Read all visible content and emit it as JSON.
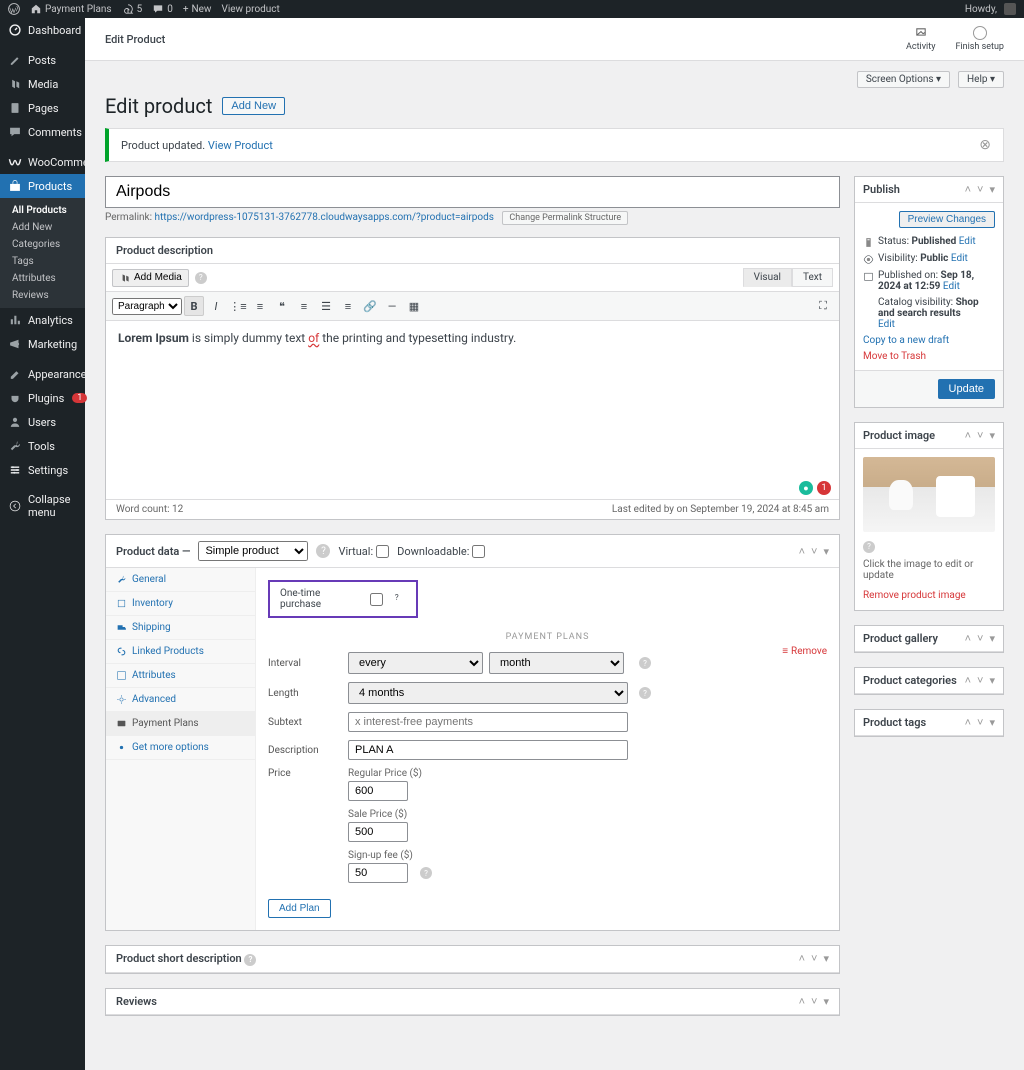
{
  "topbar": {
    "site_name": "Payment Plans",
    "updates": "5",
    "comments": "0",
    "new": "New",
    "view": "View product",
    "howdy": "Howdy,"
  },
  "sidebar": {
    "items": [
      {
        "label": "Dashboard"
      },
      {
        "label": "Posts"
      },
      {
        "label": "Media"
      },
      {
        "label": "Pages"
      },
      {
        "label": "Comments"
      },
      {
        "label": "WooCommerce"
      },
      {
        "label": "Products"
      },
      {
        "label": "Analytics"
      },
      {
        "label": "Marketing"
      },
      {
        "label": "Appearance"
      },
      {
        "label": "Plugins"
      },
      {
        "label": "Users"
      },
      {
        "label": "Tools"
      },
      {
        "label": "Settings"
      },
      {
        "label": "Collapse menu"
      }
    ],
    "plugins_badge": "1",
    "sub": [
      {
        "label": "All Products"
      },
      {
        "label": "Add New"
      },
      {
        "label": "Categories"
      },
      {
        "label": "Tags"
      },
      {
        "label": "Attributes"
      },
      {
        "label": "Reviews"
      }
    ]
  },
  "breadcrumb": "Edit Product",
  "setup": {
    "activity": "Activity",
    "finish": "Finish setup"
  },
  "screen_options": "Screen Options ▾",
  "help": "Help ▾",
  "page_title": "Edit product",
  "add_new": "Add New",
  "notice": {
    "text": "Product updated. ",
    "link": "View Product"
  },
  "product": {
    "title": "Airpods",
    "permalink_label": "Permalink:",
    "permalink_url": "https://wordpress-1075131-3762778.cloudwaysapps.com/?product=airpods",
    "change_permalink": "Change Permalink Structure"
  },
  "description": {
    "heading": "Product description",
    "add_media": "Add Media",
    "tabs": {
      "visual": "Visual",
      "text": "Text"
    },
    "paragraph": "Paragraph",
    "content_bold": "Lorem Ipsum",
    "content_rest_1": " is simply dummy text ",
    "content_err": "of",
    "content_rest_2": " the printing and typesetting industry.",
    "word_count": "Word count: 12",
    "last_edited": "Last edited by on September 19, 2024 at 8:45 am",
    "badge_count": "1"
  },
  "product_data": {
    "heading": "Product data —",
    "type": "Simple product",
    "virtual": "Virtual:",
    "downloadable": "Downloadable:",
    "tabs": [
      "General",
      "Inventory",
      "Shipping",
      "Linked Products",
      "Attributes",
      "Advanced",
      "Payment Plans",
      "Get more options"
    ],
    "otp": "One-time purchase",
    "pp_heading": "PAYMENT PLANS",
    "remove": "Remove",
    "fields": {
      "interval": "Interval",
      "interval_every": "every",
      "interval_unit": "month",
      "length": "Length",
      "length_val": "4 months",
      "subtext": "Subtext",
      "subtext_ph": "x interest-free payments",
      "description": "Description",
      "description_val": "PLAN A",
      "price": "Price",
      "regular": "Regular Price ($)",
      "regular_val": "600",
      "sale": "Sale Price ($)",
      "sale_val": "500",
      "signup": "Sign-up fee ($)",
      "signup_val": "50"
    },
    "add_plan": "Add Plan"
  },
  "short_desc": {
    "heading": "Product short description"
  },
  "reviews": {
    "heading": "Reviews"
  },
  "publish": {
    "heading": "Publish",
    "preview": "Preview Changes",
    "status_lbl": "Status:",
    "status": "Published",
    "edit": "Edit",
    "visibility_lbl": "Visibility:",
    "visibility": "Public",
    "published_lbl": "Published on:",
    "published": "Sep 18, 2024 at 12:59",
    "catalog_lbl": "Catalog visibility:",
    "catalog": "Shop and search results",
    "copy": "Copy to a new draft",
    "trash": "Move to Trash",
    "update": "Update"
  },
  "product_image": {
    "heading": "Product image",
    "click_text": "Click the image to edit or update",
    "remove": "Remove product image"
  },
  "gallery": {
    "heading": "Product gallery"
  },
  "categories": {
    "heading": "Product categories"
  },
  "tags": {
    "heading": "Product tags"
  }
}
